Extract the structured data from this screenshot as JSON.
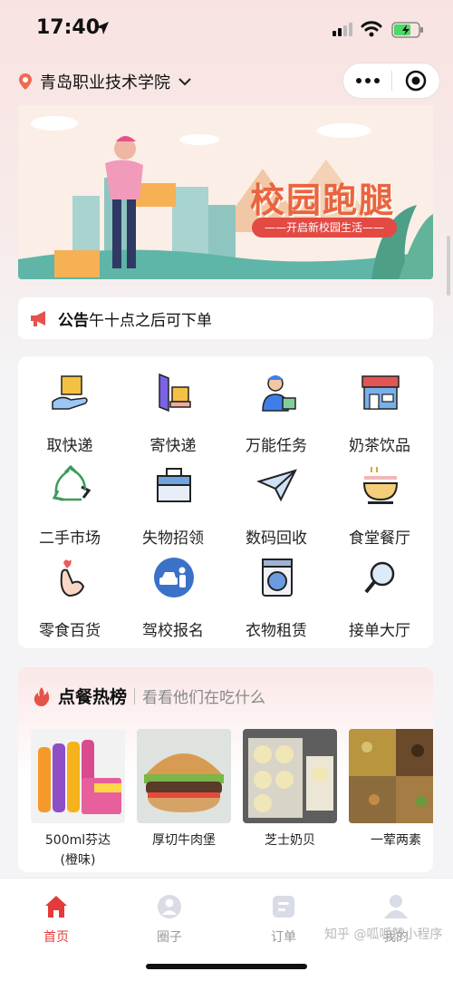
{
  "status_bar": {
    "time": "17:40"
  },
  "location": {
    "name": "青岛职业技术学院"
  },
  "banner": {
    "title": "校园跑腿",
    "subtitle": "——开启新校园生活——"
  },
  "notice": {
    "label": "公告",
    "text": "午十点之后可下单"
  },
  "services": [
    {
      "label": "取快递",
      "icon": "package-hand-icon"
    },
    {
      "label": "寄快递",
      "icon": "send-package-icon"
    },
    {
      "label": "万能任务",
      "icon": "courier-icon"
    },
    {
      "label": "奶茶饮品",
      "icon": "shop-icon"
    },
    {
      "label": "二手市场",
      "icon": "recycle-icon"
    },
    {
      "label": "失物招领",
      "icon": "briefcase-icon"
    },
    {
      "label": "数码回收",
      "icon": "paper-plane-icon"
    },
    {
      "label": "食堂餐厅",
      "icon": "bowl-icon"
    },
    {
      "label": "零食百货",
      "icon": "heart-hand-icon"
    },
    {
      "label": "驾校报名",
      "icon": "car-person-icon"
    },
    {
      "label": "衣物租赁",
      "icon": "washing-machine-icon"
    },
    {
      "label": "接单大厅",
      "icon": "magnifier-icon"
    }
  ],
  "hot": {
    "title": "点餐热榜",
    "subtitle": "看看他们在吃什么",
    "items": [
      {
        "name": "500ml芬达",
        "name2": "(橙味)"
      },
      {
        "name": "厚切牛肉堡"
      },
      {
        "name": "芝士奶贝"
      },
      {
        "name": "一荤两素"
      }
    ]
  },
  "tabbar": [
    {
      "label": "首页",
      "active": true
    },
    {
      "label": "圈子"
    },
    {
      "label": "订单"
    },
    {
      "label": "我的"
    }
  ],
  "watermark": "知乎 @呱呱赞小程序",
  "colors": {
    "accent": "#e43a3a",
    "banner_title": "#e9643f"
  }
}
